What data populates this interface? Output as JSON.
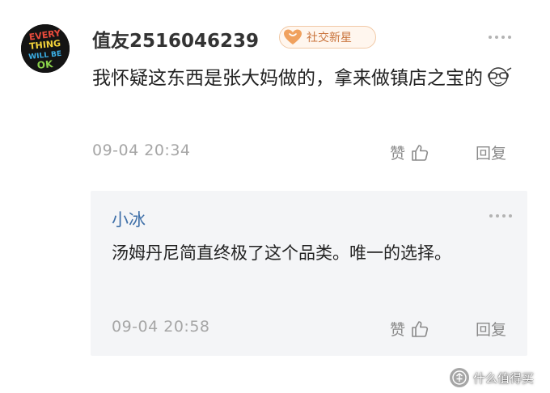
{
  "comment": {
    "username": "值友2516046239",
    "badge": "社交新星",
    "text": "我怀疑这东西是张大妈做的，拿来做镇店之宝的",
    "time": "09-04 20:34",
    "like_label": "赞",
    "reply_label": "回复",
    "avatar_text": [
      "EVERY",
      "THING",
      "WILL BE",
      "OK"
    ]
  },
  "reply": {
    "username": "小冰",
    "text": "汤姆丹尼简直终极了这个品类。唯一的选择。",
    "time": "09-04 20:58",
    "like_label": "赞",
    "reply_label": "回复"
  },
  "watermark": {
    "text": "什么值得买"
  },
  "colors": {
    "reply_name": "#3e6fa8",
    "badge_text": "#c9733b",
    "badge_heart": "#f0a15e",
    "reply_bg": "#f4f5f7",
    "meta": "#a6a6a6"
  },
  "icons": {
    "more": "more-dots-icon",
    "like": "thumbs-up-icon",
    "badge": "heart-icon",
    "emoji": "sunglasses-emoji-icon",
    "watermark": "smzdm-logo-icon"
  }
}
